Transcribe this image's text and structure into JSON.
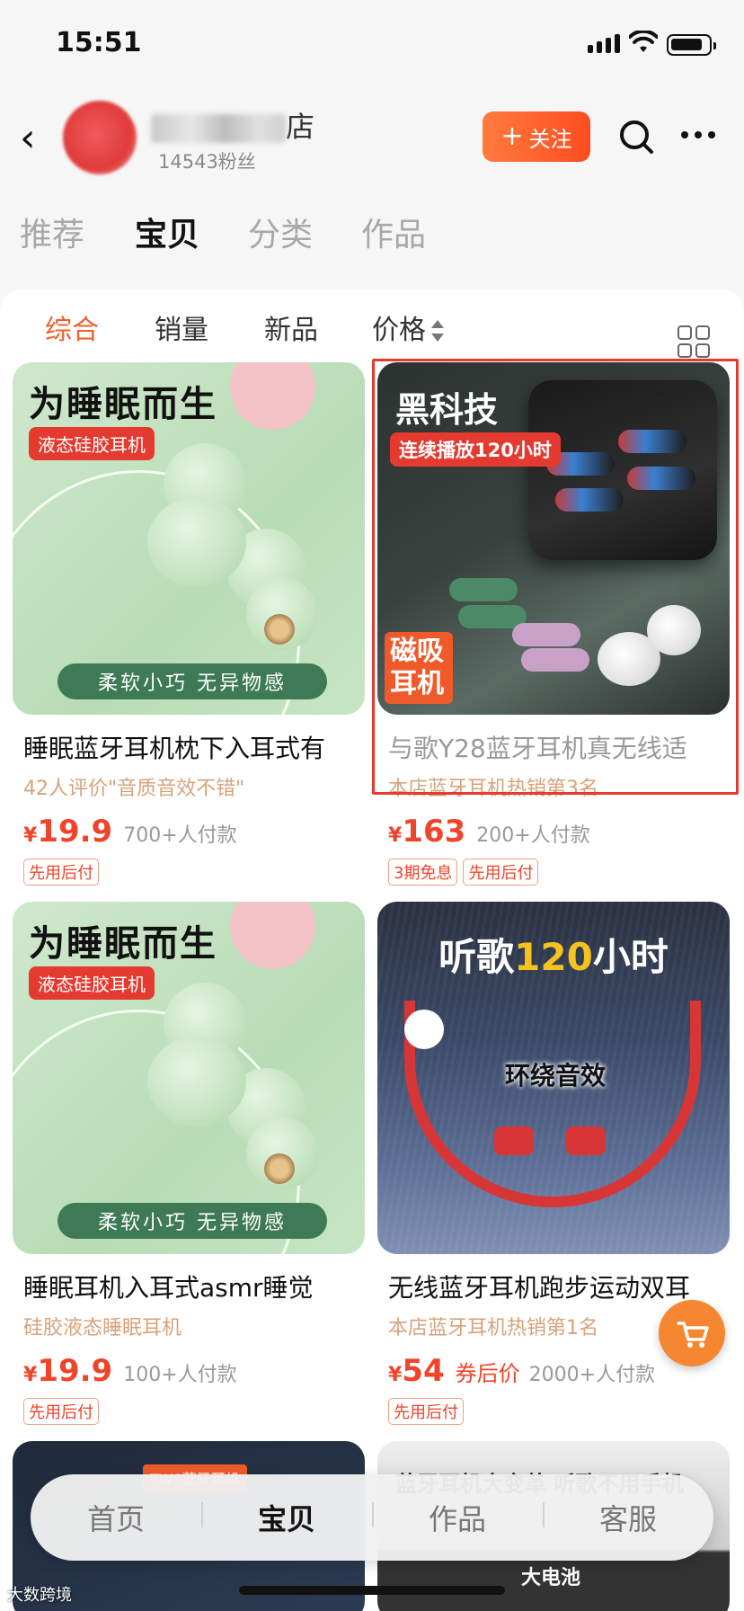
{
  "status_bar": {
    "time": "15:51"
  },
  "shop": {
    "name_visible": "店",
    "fans": "14543粉丝",
    "follow_label": "关注"
  },
  "tabs": [
    {
      "label": "推荐",
      "active": false
    },
    {
      "label": "宝贝",
      "active": true
    },
    {
      "label": "分类",
      "active": false
    },
    {
      "label": "作品",
      "active": false
    }
  ],
  "sort_bar": {
    "items": [
      "综合",
      "销量",
      "新品",
      "价格"
    ],
    "active": "综合"
  },
  "products": [
    {
      "image_text": {
        "headline": "为睡眠而生",
        "badge": "液态硅胶耳机",
        "footer": "柔软小巧 无异物感"
      },
      "title": "睡眠蓝牙耳机枕下入耳式有",
      "subtitle": "42人评价\"音质音效不错\"",
      "currency": "¥",
      "price": "19.9",
      "coupon": "",
      "paid": "700+人付款",
      "tags": [
        "先用后付"
      ]
    },
    {
      "image_text": {
        "headline": "黑科技",
        "badge": "连续播放120小时",
        "side_tag": "磁吸耳机"
      },
      "title": "与歌Y28蓝牙耳机真无线适",
      "subtitle": "本店蓝牙耳机热销第3名",
      "currency": "¥",
      "price": "163",
      "coupon": "",
      "paid": "200+人付款",
      "tags": [
        "3期免息",
        "先用后付"
      ]
    },
    {
      "image_text": {
        "headline": "为睡眠而生",
        "badge": "液态硅胶耳机",
        "footer": "柔软小巧 无异物感"
      },
      "title": "睡眠耳机入耳式asmr睡觉",
      "subtitle": "硅胶液态睡眠耳机",
      "currency": "¥",
      "price": "19.9",
      "coupon": "",
      "paid": "100+人付款",
      "tags": [
        "先用后付"
      ]
    },
    {
      "image_text": {
        "headline_pre": "听歌",
        "headline_hl": "120",
        "headline_post": "小时",
        "middle": "环绕音效"
      },
      "title": "无线蓝牙耳机跑步运动双耳",
      "subtitle": "本店蓝牙耳机热销第1名",
      "currency": "¥",
      "price": "54",
      "coupon": "券后价",
      "paid": "2000+人付款",
      "tags": [
        "先用后付"
      ]
    }
  ],
  "partial_row": {
    "left_badge": "TWS蓝牙耳机",
    "right_text": "蓝牙耳机大变革 听歌不用手机",
    "right_sub": "大电池"
  },
  "bottom_nav": [
    {
      "label": "首页",
      "active": false
    },
    {
      "label": "宝贝",
      "active": true
    },
    {
      "label": "作品",
      "active": false
    },
    {
      "label": "客服",
      "active": false
    }
  ],
  "watermark": "大数跨境",
  "colors": {
    "accent": "#f0602e",
    "price": "#f0442a",
    "highlight_box": "#e53a2f"
  }
}
